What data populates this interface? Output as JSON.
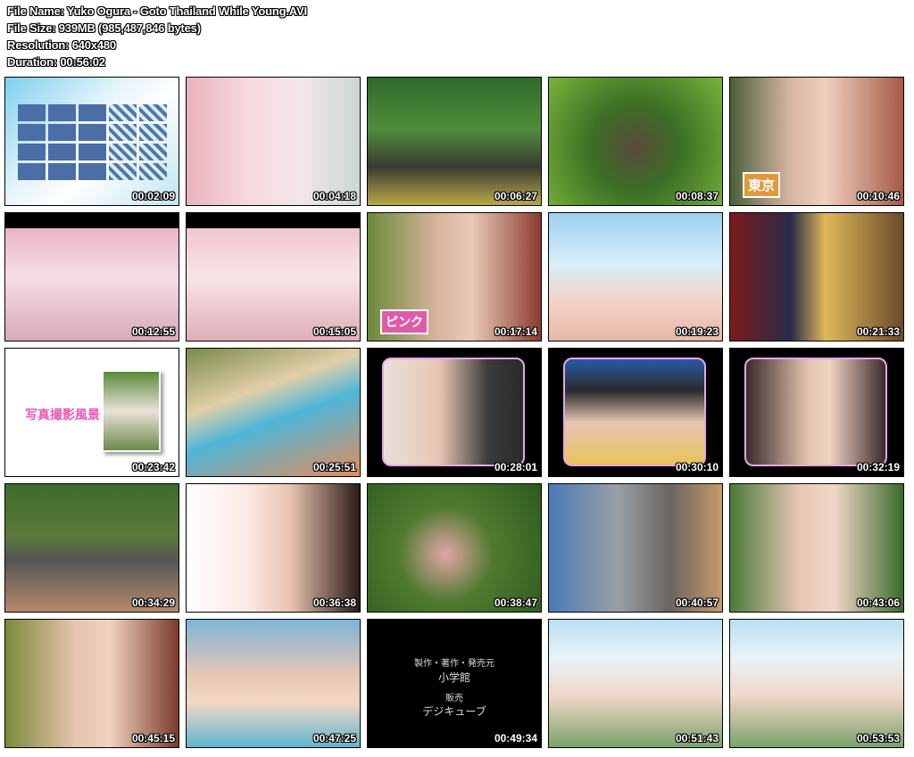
{
  "header": {
    "file_name": "File Name: Yuko Ogura - Goto Thailand While Young.AVI",
    "file_size": "File Size: 939MB (985,487,846 bytes)",
    "resolution": "Resolution: 640x480",
    "duration": "Duration: 00:56:02"
  },
  "thumbnails": [
    {
      "time": "00:02:09",
      "bg": "linear-gradient(135deg,#7fd0ee 0%,#e4f4fb 40%,#ffffff 60%,#bfe4f2 100%)"
    },
    {
      "time": "00:04:18",
      "bg": "linear-gradient(90deg,#e9b3bd 0%,#f7d8df 35%,#f3e6e8 65%,#cdd7d3 100%)"
    },
    {
      "time": "00:06:27",
      "bg": "linear-gradient(180deg,#2f6a2a 0%,#4f8d3b 40%,#3a3a32 70%,#b9a84a 100%)"
    },
    {
      "time": "00:08:37",
      "bg": "radial-gradient(circle at 50% 55%,#5a4a3a 0%,#3b6f25 40%,#79b33a 100%)"
    },
    {
      "time": "00:10:46",
      "bg": "linear-gradient(90deg,#4a5f3a 0%,#d9b6a3 35%,#f0cfc0 55%,#a65a45 100%)"
    },
    {
      "time": "00:12:55",
      "bg": "linear-gradient(180deg,#000 0%,#000 12%,#e8b6c6 12%,#f6dde6 50%,#d7aab8 100%)"
    },
    {
      "time": "00:15:05",
      "bg": "linear-gradient(180deg,#000 0%,#000 12%,#f0c6cd 12%,#f8e4e7 50%,#e0aeb8 100%)"
    },
    {
      "time": "00:17:14",
      "bg": "linear-gradient(90deg,#6b8a3a 0%,#d6b39c 40%,#e8cab5 60%,#8c3b2f 100%)"
    },
    {
      "time": "00:19:23",
      "bg": "linear-gradient(180deg,#9fd0ef 0%,#d7eef9 40%,#f4d1c6 70%,#e6b8a8 100%)"
    },
    {
      "time": "00:21:33",
      "bg": "linear-gradient(90deg,#7a1b1b 0%,#2a2a4a 35%,#e0b85a 55%,#6b4a2a 100%)"
    },
    {
      "time": "00:23:42",
      "bg": "#ffffff"
    },
    {
      "time": "00:25:51",
      "bg": "linear-gradient(160deg,#7a8a4a 0%,#e2cfa8 35%,#4fb6d8 55%,#e28c5a 100%)"
    },
    {
      "time": "00:28:01",
      "bg": "#000000"
    },
    {
      "time": "00:30:10",
      "bg": "#000000"
    },
    {
      "time": "00:32:19",
      "bg": "#000000"
    },
    {
      "time": "00:34:29",
      "bg": "linear-gradient(180deg,#3e6a2a 0%,#5a7a3a 40%,#555 60%,#b58a6a 100%)"
    },
    {
      "time": "00:36:38",
      "bg": "linear-gradient(90deg,#ffffff 0%,#fbe9e4 35%,#e8c3b0 60%,#2a1a15 100%)"
    },
    {
      "time": "00:38:47",
      "bg": "radial-gradient(circle at 45% 55%,#e3a6a6 0%,#4f7a2f 40%,#2d5a1e 100%)"
    },
    {
      "time": "00:40:57",
      "bg": "linear-gradient(90deg,#4a7ab8 0%,#9aa0a6 40%,#6a6460 70%,#c79a6a 100%)"
    },
    {
      "time": "00:43:06",
      "bg": "linear-gradient(90deg,#4a7a3a 0%,#e7c7b5 40%,#f2d8c9 60%,#3a6a2a 100%)"
    },
    {
      "time": "00:45:15",
      "bg": "linear-gradient(90deg,#7a8a3a 0%,#e5c3ad 40%,#f0d3c0 60%,#7a3a2a 100%)"
    },
    {
      "time": "00:47:25",
      "bg": "linear-gradient(180deg,#7fb3d8 0%,#e9c8b3 45%,#f3d7c6 65%,#5fb5d0 100%)"
    },
    {
      "time": "00:49:34",
      "bg": "#000000"
    },
    {
      "time": "00:51:43",
      "bg": "linear-gradient(180deg,#b9dff2 0%,#e8f3f7 30%,#f0d6c8 60%,#7aa36a 100%)"
    },
    {
      "time": "00:53:53",
      "bg": "linear-gradient(180deg,#b9dff2 0%,#e8f3f7 30%,#f0d6c8 60%,#7aa36a 100%)"
    }
  ],
  "overlays": {
    "tokyo_caption": "東京",
    "pink_caption": "ピンク",
    "photo_caption": "写真撮影風景"
  },
  "credits": {
    "line1": "製作・著作・発売元",
    "line2": "小学館",
    "line3": "販売",
    "line4": "デジキューブ"
  }
}
